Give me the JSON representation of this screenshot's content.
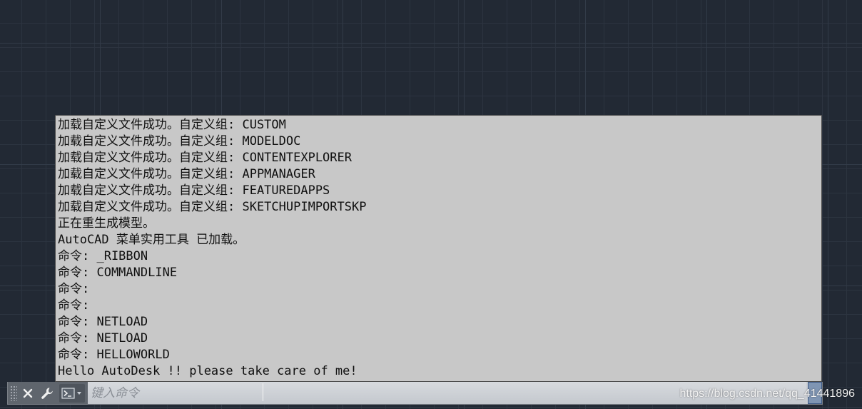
{
  "history": [
    "加载自定义文件成功。自定义组: CUSTOM",
    "加载自定义文件成功。自定义组: MODELDOC",
    "加载自定义文件成功。自定义组: CONTENTEXPLORER",
    "加载自定义文件成功。自定义组: APPMANAGER",
    "加载自定义文件成功。自定义组: FEATUREDAPPS",
    "加载自定义文件成功。自定义组: SKETCHUPIMPORTSKP",
    "正在重生成模型。",
    "AutoCAD 菜单实用工具 已加载。",
    "命令: _RIBBON",
    "命令: COMMANDLINE",
    "命令:",
    "命令:",
    "命令: NETLOAD",
    "命令: NETLOAD",
    "命令: HELLOWORLD",
    "Hello AutoDesk !! please take care of me!"
  ],
  "command_bar": {
    "placeholder": "键入命令",
    "icons": {
      "close": "close-icon",
      "customize": "wrench-icon",
      "recent": "command-prompt-icon"
    }
  },
  "watermark": "https://blog.csdn.net/qq_41441896",
  "colors": {
    "canvas_bg": "#222934",
    "history_bg": "#c8c8c8",
    "command_bar_bg": "#c9cdd3"
  }
}
